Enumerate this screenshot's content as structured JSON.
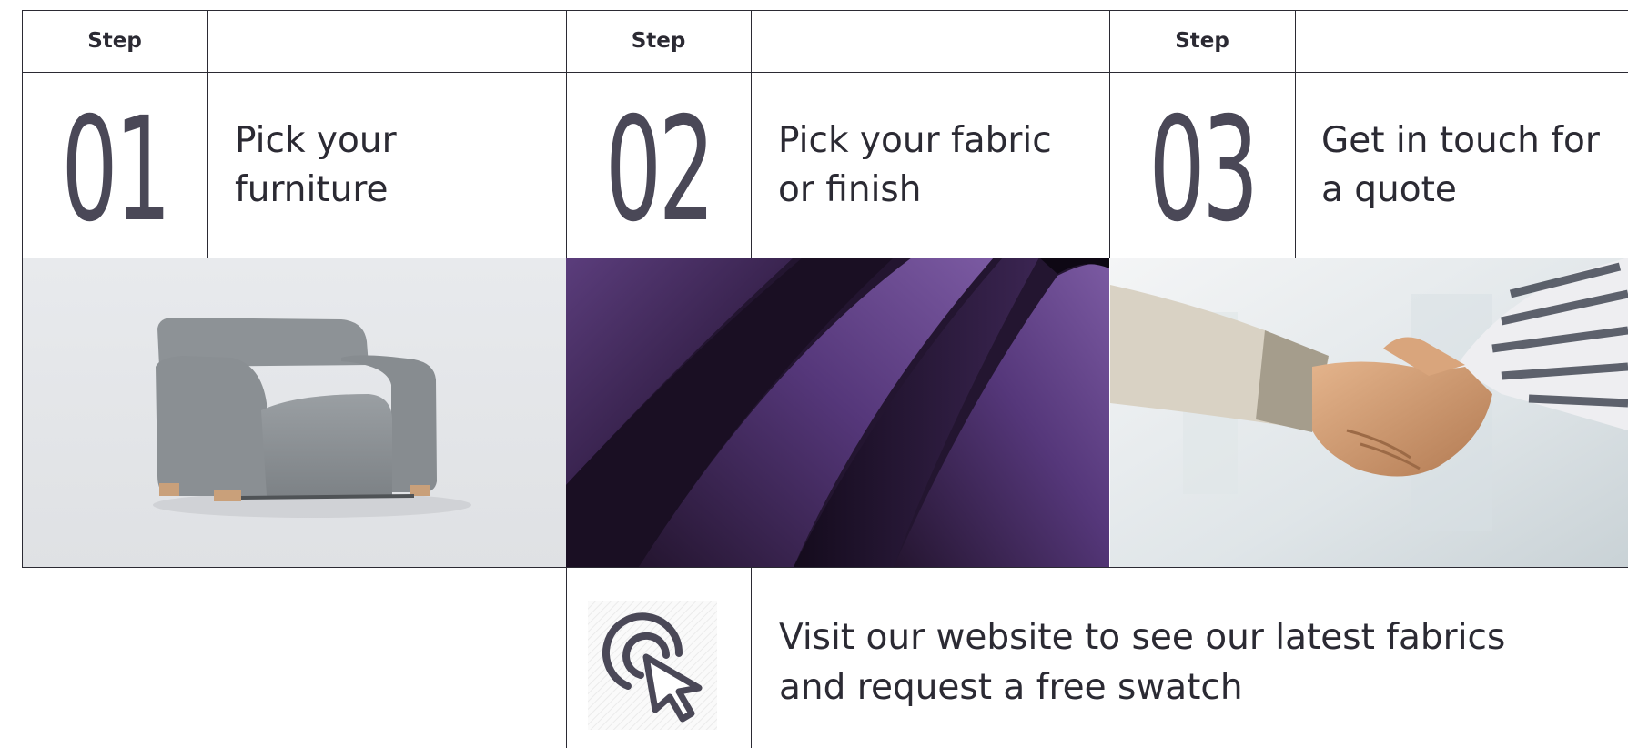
{
  "steps": [
    {
      "label": "Step",
      "number": "01",
      "text_line1": "Pick your",
      "text_line2": "furniture"
    },
    {
      "label": "Step",
      "number": "02",
      "text_line1": "Pick your fabric",
      "text_line2": "or finish"
    },
    {
      "label": "Step",
      "number": "03",
      "text_line1": "Get in touch for",
      "text_line2": "a quote"
    }
  ],
  "images": [
    {
      "name": "armchair-photo",
      "background": "#e4e6e9",
      "upholstery": "#8a8f93"
    },
    {
      "name": "purple-leather-photo",
      "background": "#2a1a36",
      "accent": "#6a4790"
    },
    {
      "name": "handshake-photo",
      "background": "#e9ecef"
    }
  ],
  "cta": {
    "icon": "cursor-click-icon",
    "line1": "Visit our website to see our latest fabrics",
    "line2": "and request a free swatch"
  },
  "colors": {
    "border": "#2b2a33",
    "number": "#4a4857"
  }
}
